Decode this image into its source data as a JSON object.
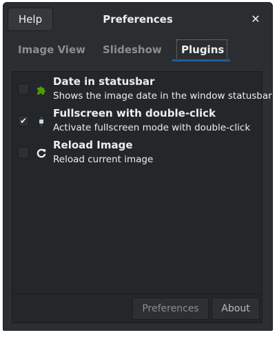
{
  "header": {
    "help_label": "Help",
    "title": "Preferences",
    "close_glyph": "✕"
  },
  "tabs": [
    {
      "label": "Image View",
      "active": false
    },
    {
      "label": "Slideshow",
      "active": false
    },
    {
      "label": "Plugins",
      "active": true
    }
  ],
  "plugins": [
    {
      "name": "Date in statusbar",
      "description": "Shows the image date in the window statusbar",
      "enabled": false,
      "icon": "puzzle-icon"
    },
    {
      "name": "Fullscreen with double-click",
      "description": "Activate fullscreen mode with double-click",
      "enabled": true,
      "icon": "fullscreen-icon"
    },
    {
      "name": "Reload Image",
      "description": "Reload current image",
      "enabled": false,
      "icon": "reload-icon"
    }
  ],
  "footer": {
    "preferences_label": "Preferences",
    "about_label": "About"
  },
  "checkmark": "✔",
  "colors": {
    "accent": "#215d9c",
    "puzzle": "#4e9a06",
    "background": "#2c2f31"
  }
}
